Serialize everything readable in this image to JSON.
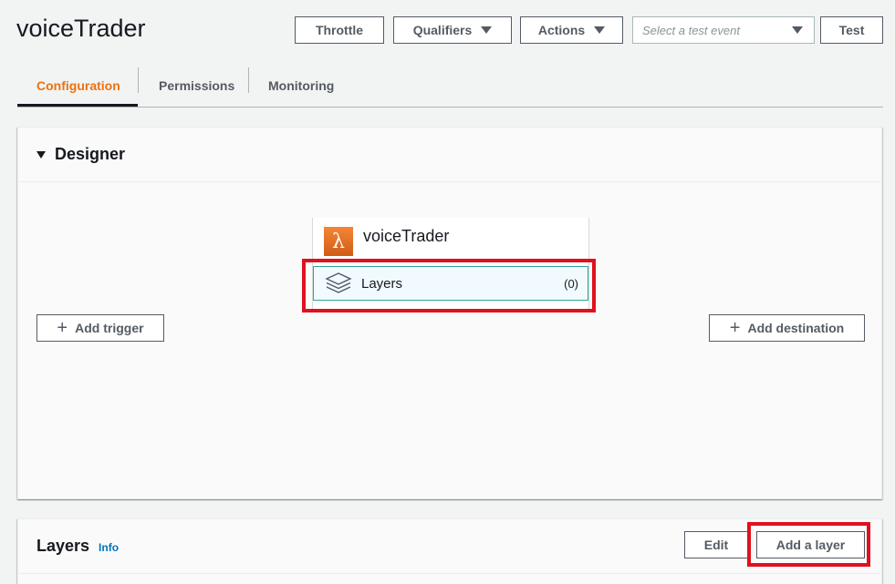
{
  "function": {
    "name": "voiceTrader"
  },
  "toolbar": {
    "throttle_label": "Throttle",
    "qualifiers_label": "Qualifiers",
    "actions_label": "Actions",
    "test_event_placeholder": "Select a test event",
    "test_label": "Test"
  },
  "tabs": [
    {
      "label": "Configuration",
      "active": true
    },
    {
      "label": "Permissions",
      "active": false
    },
    {
      "label": "Monitoring",
      "active": false
    }
  ],
  "designer": {
    "title": "Designer",
    "function_name": "voiceTrader",
    "layers_label": "Layers",
    "layers_count": "(0)",
    "add_trigger_label": "Add trigger",
    "add_destination_label": "Add destination"
  },
  "layers_section": {
    "title": "Layers",
    "info_label": "Info",
    "edit_label": "Edit",
    "add_layer_label": "Add a layer"
  },
  "colors": {
    "accent": "#ec7211",
    "highlight": "#e0111f",
    "link": "#0073bb",
    "layers_border": "#2fa59b"
  },
  "icons": {
    "lambda": "lambda-icon",
    "layers": "layers-stack-icon",
    "caret": "caret-down-icon",
    "plus": "plus-icon"
  }
}
